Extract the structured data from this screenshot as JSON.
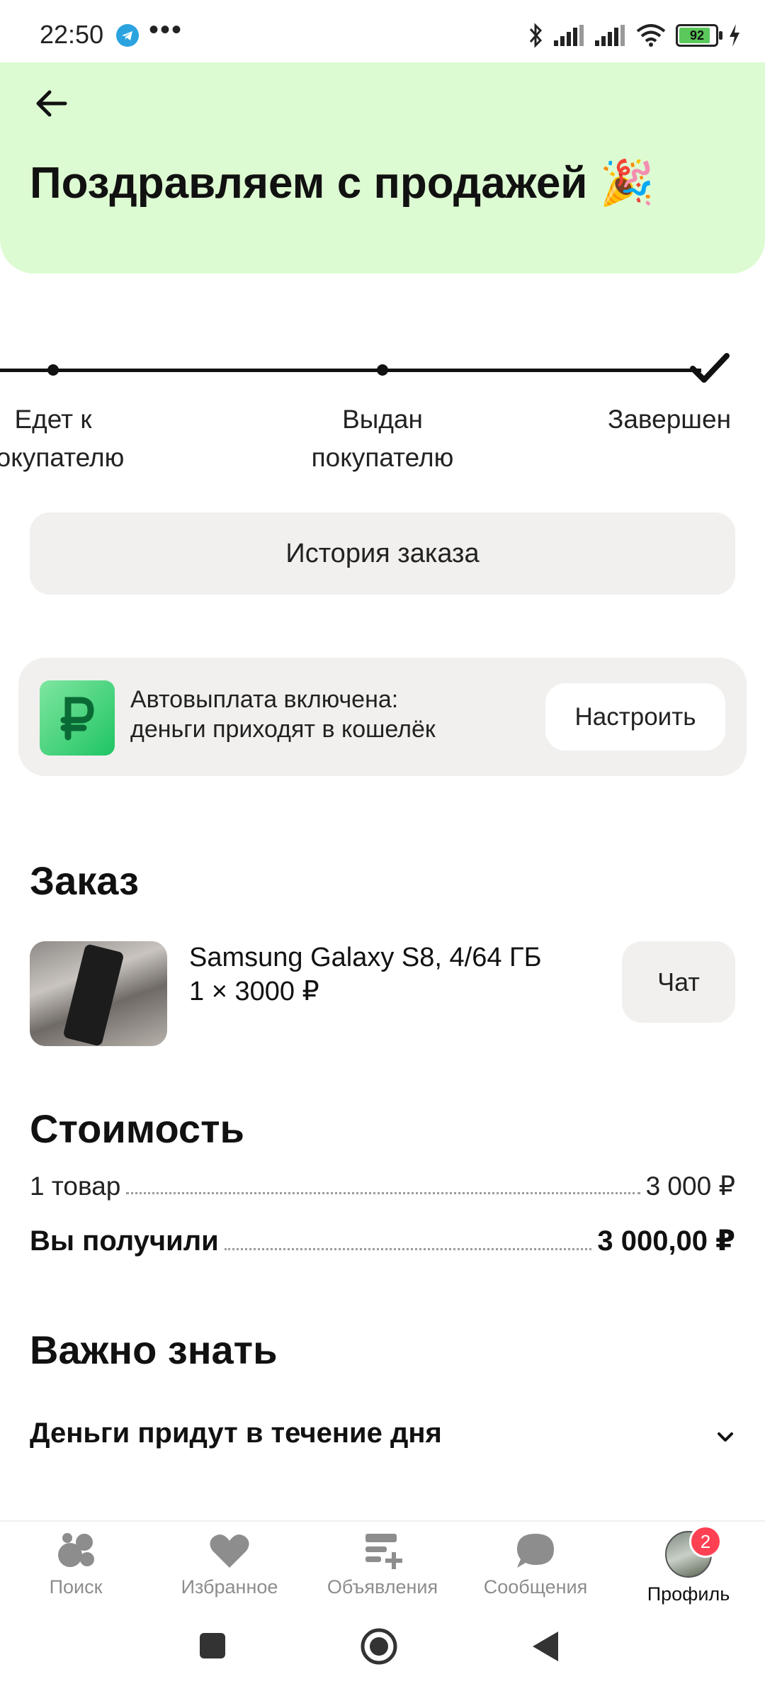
{
  "status_bar": {
    "time": "22:50",
    "dots": "•••",
    "battery": "92",
    "colors": {
      "telegram": "#2aa3df",
      "battery_fill": "#5ac85a"
    }
  },
  "header": {
    "title": "Поздравляем с продажей 🎉",
    "background": "#ddfbd2"
  },
  "progress": {
    "steps": [
      {
        "label": "Едет к покупателю"
      },
      {
        "label": "Выдан покупателю"
      },
      {
        "label": "Завершен"
      }
    ],
    "current_step": "Завершен"
  },
  "history_button": "История заказа",
  "autopay": {
    "line1": "Автовыплата включена:",
    "line2": "деньги приходят в кошелёк",
    "setup_button": "Настроить",
    "icon": "ruble-wallet-icon"
  },
  "order": {
    "heading": "Заказ",
    "product_name": "Samsung Galaxy S8, 4/64 ГБ",
    "quantity_price": "1 × 3000 ₽",
    "chat_button": "Чат"
  },
  "cost": {
    "heading": "Стоимость",
    "items_label": "1 товар",
    "items_value": "3 000 ₽",
    "received_label": "Вы получили",
    "received_value": "3 000,00 ₽"
  },
  "important": {
    "heading": "Важно знать",
    "item": "Деньги придут в течение дня"
  },
  "bottom_nav": {
    "items": [
      {
        "label": "Поиск",
        "icon": "search-bubbles-icon"
      },
      {
        "label": "Избранное",
        "icon": "heart-icon"
      },
      {
        "label": "Объявления",
        "icon": "ads-list-icon"
      },
      {
        "label": "Сообщения",
        "icon": "chat-bubble-icon"
      },
      {
        "label": "Профиль",
        "icon": "avatar"
      }
    ],
    "active": "Профиль",
    "profile_badge": "2"
  }
}
